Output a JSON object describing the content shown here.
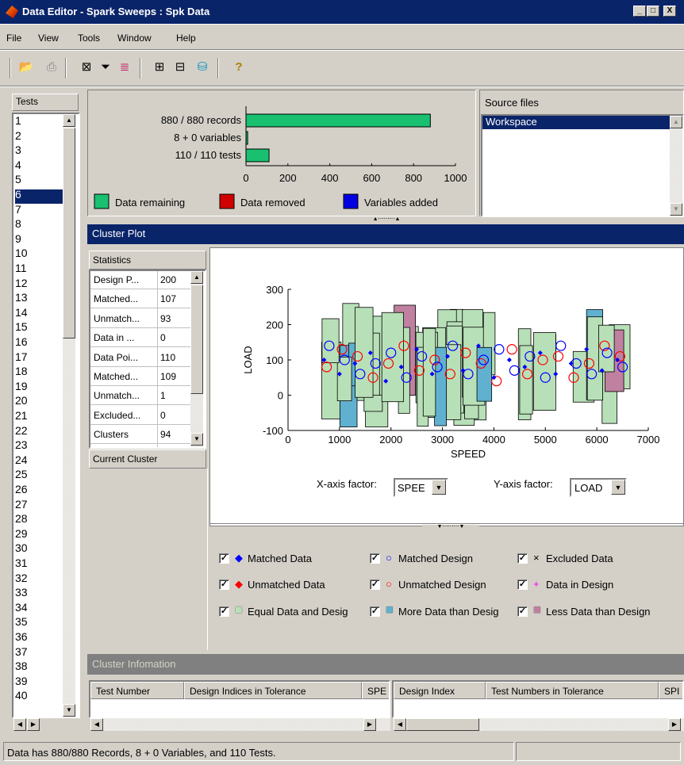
{
  "window": {
    "title": "Data Editor - Spark Sweeps : Spk Data",
    "min": "_",
    "max": "□",
    "close": "X"
  },
  "menu": [
    "File",
    "View",
    "Tools",
    "Window",
    "Help"
  ],
  "toolbar": {
    "icons": [
      "open-folder-icon",
      "print-icon",
      "edit-variables-icon",
      "filter-icon",
      "test-filter-icon",
      "horizontal-split-icon",
      "vertical-split-icon",
      "storage-icon",
      "help-icon"
    ]
  },
  "tests": {
    "header": "Tests",
    "items": [
      "1",
      "2",
      "3",
      "4",
      "5",
      "6",
      "7",
      "8",
      "9",
      "10",
      "11",
      "12",
      "13",
      "14",
      "15",
      "16",
      "17",
      "18",
      "19",
      "20",
      "21",
      "22",
      "23",
      "24",
      "25",
      "26",
      "27",
      "28",
      "29",
      "30",
      "31",
      "32",
      "33",
      "34",
      "35",
      "36",
      "37",
      "38",
      "39",
      "40"
    ],
    "selected_index": 5
  },
  "summary": {
    "bars": [
      {
        "label": "880 / 880 records",
        "value": 880
      },
      {
        "label": "8 + 0 variables",
        "value": 8
      },
      {
        "label": "110 / 110 tests",
        "value": 110
      }
    ],
    "ticks": [
      "0",
      "200",
      "400",
      "600",
      "800",
      "1000"
    ],
    "xmax": 1000,
    "legend": [
      {
        "label": "Data remaining",
        "color": "#18c070"
      },
      {
        "label": "Data removed",
        "color": "#d00000"
      },
      {
        "label": "Variables added",
        "color": "#0000e0"
      }
    ]
  },
  "source_files": {
    "header": "Source files",
    "items": [
      "Workspace"
    ]
  },
  "cluster_plot": {
    "title": "Cluster Plot",
    "statistics": {
      "header": "Statistics",
      "rows": [
        {
          "name": "Design P...",
          "value": "200"
        },
        {
          "name": "Matched...",
          "value": "107"
        },
        {
          "name": "Unmatch...",
          "value": "93"
        },
        {
          "name": "Data in ...",
          "value": "0"
        },
        {
          "name": "Data Poi...",
          "value": "110"
        },
        {
          "name": "Matched...",
          "value": "109"
        },
        {
          "name": "Unmatch...",
          "value": "1"
        },
        {
          "name": "Excluded...",
          "value": "0"
        },
        {
          "name": "Clusters",
          "value": "94"
        }
      ]
    },
    "current_cluster": "Current Cluster",
    "x_factor_label": "X-axis factor:",
    "x_factor_value": "SPEE",
    "y_factor_label": "Y-axis factor:",
    "y_factor_value": "LOAD",
    "legend_items": [
      {
        "label": "Matched Data",
        "symbol": "◆",
        "color": "#0000ff"
      },
      {
        "label": "Matched Design",
        "symbol": "○",
        "color": "#0000ff"
      },
      {
        "label": "Excluded Data",
        "symbol": "×",
        "color": "#000000"
      },
      {
        "label": "Unmatched Data",
        "symbol": "◆",
        "color": "#ff0000"
      },
      {
        "label": "Unmatched Design",
        "symbol": "○",
        "color": "#ff0000"
      },
      {
        "label": "Data in Design",
        "symbol": "+",
        "color": "#ff00ff"
      },
      {
        "label": "Equal Data and Desig",
        "symbol": "■",
        "color": "#b8e0b8"
      },
      {
        "label": "More Data than Desig",
        "symbol": "■",
        "color": "#60b0d0"
      },
      {
        "label": "Less Data than Design",
        "symbol": "■",
        "color": "#c080a0"
      }
    ]
  },
  "chart_data": {
    "type": "scatter",
    "xlabel": "SPEED",
    "ylabel": "LOAD",
    "xlim": [
      0,
      7000
    ],
    "ylim": [
      -100,
      300
    ],
    "xticks": [
      "0",
      "1000",
      "2000",
      "3000",
      "4000",
      "5000",
      "6000",
      "7000"
    ],
    "yticks": [
      "-100",
      "0",
      "100",
      "200",
      "300"
    ],
    "series": [
      {
        "name": "Matched Data",
        "values": [
          [
            700,
            100
          ],
          [
            1000,
            60
          ],
          [
            1300,
            90
          ],
          [
            1600,
            120
          ],
          [
            1900,
            40
          ],
          [
            2200,
            80
          ],
          [
            2500,
            130
          ],
          [
            2800,
            60
          ],
          [
            3100,
            110
          ],
          [
            3400,
            70
          ],
          [
            3700,
            140
          ],
          [
            4000,
            50
          ],
          [
            4300,
            100
          ],
          [
            4600,
            80
          ],
          [
            4900,
            120
          ],
          [
            5200,
            60
          ],
          [
            5500,
            90
          ],
          [
            5800,
            130
          ],
          [
            6100,
            70
          ],
          [
            6400,
            100
          ]
        ]
      },
      {
        "name": "Matched Design",
        "values": [
          [
            800,
            140
          ],
          [
            1100,
            100
          ],
          [
            1400,
            60
          ],
          [
            1700,
            90
          ],
          [
            2000,
            120
          ],
          [
            2300,
            50
          ],
          [
            2600,
            110
          ],
          [
            2900,
            80
          ],
          [
            3200,
            140
          ],
          [
            3500,
            60
          ],
          [
            3800,
            100
          ],
          [
            4100,
            130
          ],
          [
            4400,
            70
          ],
          [
            4700,
            110
          ],
          [
            5000,
            50
          ],
          [
            5300,
            140
          ],
          [
            5600,
            90
          ],
          [
            5900,
            60
          ],
          [
            6200,
            120
          ],
          [
            6500,
            80
          ]
        ]
      },
      {
        "name": "Unmatched Design",
        "values": [
          [
            750,
            80
          ],
          [
            1050,
            130
          ],
          [
            1350,
            110
          ],
          [
            1650,
            50
          ],
          [
            1950,
            90
          ],
          [
            2250,
            140
          ],
          [
            2550,
            70
          ],
          [
            2850,
            100
          ],
          [
            3150,
            60
          ],
          [
            3450,
            120
          ],
          [
            3750,
            90
          ],
          [
            4050,
            40
          ],
          [
            4350,
            130
          ],
          [
            4650,
            60
          ],
          [
            4950,
            100
          ],
          [
            5250,
            110
          ],
          [
            5550,
            50
          ],
          [
            5850,
            90
          ],
          [
            6150,
            140
          ],
          [
            6450,
            110
          ]
        ]
      }
    ]
  },
  "cluster_info": {
    "title": "Cluster Infomation",
    "left_columns": [
      "Test Number",
      "Design Indices in Tolerance",
      "SPE"
    ],
    "right_columns": [
      "Design Index",
      "Test Numbers in Tolerance",
      "SPI"
    ]
  },
  "status": "Data has 880/880 Records, 8 + 0 Variables, and 110 Tests."
}
